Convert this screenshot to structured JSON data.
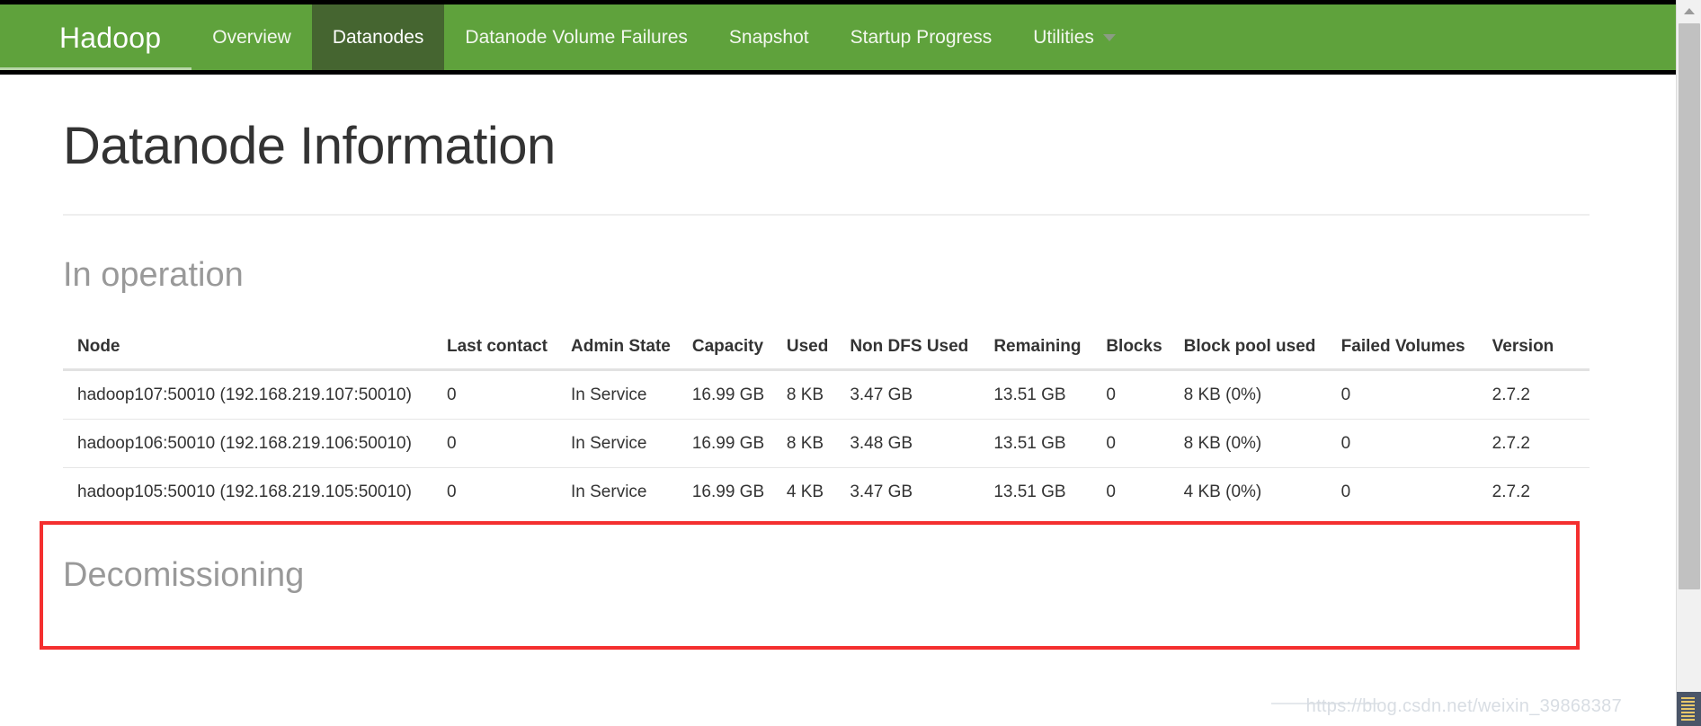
{
  "navbar": {
    "brand": "Hadoop",
    "items": [
      {
        "label": "Overview",
        "active": false,
        "caret": false
      },
      {
        "label": "Datanodes",
        "active": true,
        "caret": false
      },
      {
        "label": "Datanode Volume Failures",
        "active": false,
        "caret": false
      },
      {
        "label": "Snapshot",
        "active": false,
        "caret": false
      },
      {
        "label": "Startup Progress",
        "active": false,
        "caret": false
      },
      {
        "label": "Utilities",
        "active": false,
        "caret": true
      }
    ],
    "colors": {
      "background": "#5fa23c",
      "active_background": "#456530",
      "text": "#f2f7ee",
      "border": "#000000"
    }
  },
  "page": {
    "title": "Datanode Information"
  },
  "sections": {
    "in_operation": "In operation",
    "decommissioning": "Decomissioning"
  },
  "table": {
    "headers": [
      "Node",
      "Last contact",
      "Admin State",
      "Capacity",
      "Used",
      "Non DFS Used",
      "Remaining",
      "Blocks",
      "Block pool used",
      "Failed Volumes",
      "Version"
    ],
    "rows": [
      {
        "node": "hadoop107:50010 (192.168.219.107:50010)",
        "last_contact": "0",
        "admin_state": "In Service",
        "capacity": "16.99 GB",
        "used": "8 KB",
        "non_dfs_used": "3.47 GB",
        "remaining": "13.51 GB",
        "blocks": "0",
        "block_pool_used": "8 KB (0%)",
        "failed_volumes": "0",
        "version": "2.7.2"
      },
      {
        "node": "hadoop106:50010 (192.168.219.106:50010)",
        "last_contact": "0",
        "admin_state": "In Service",
        "capacity": "16.99 GB",
        "used": "8 KB",
        "non_dfs_used": "3.48 GB",
        "remaining": "13.51 GB",
        "blocks": "0",
        "block_pool_used": "8 KB (0%)",
        "failed_volumes": "0",
        "version": "2.7.2"
      },
      {
        "node": "hadoop105:50010 (192.168.219.105:50010)",
        "last_contact": "0",
        "admin_state": "In Service",
        "capacity": "16.99 GB",
        "used": "4 KB",
        "non_dfs_used": "3.47 GB",
        "remaining": "13.51 GB",
        "blocks": "0",
        "block_pool_used": "4 KB (0%)",
        "failed_volumes": "0",
        "version": "2.7.2"
      }
    ]
  },
  "annotation": {
    "color": "#f42f2f"
  },
  "watermark": {
    "text": "https://blog.csdn.net/weixin_39868387"
  }
}
